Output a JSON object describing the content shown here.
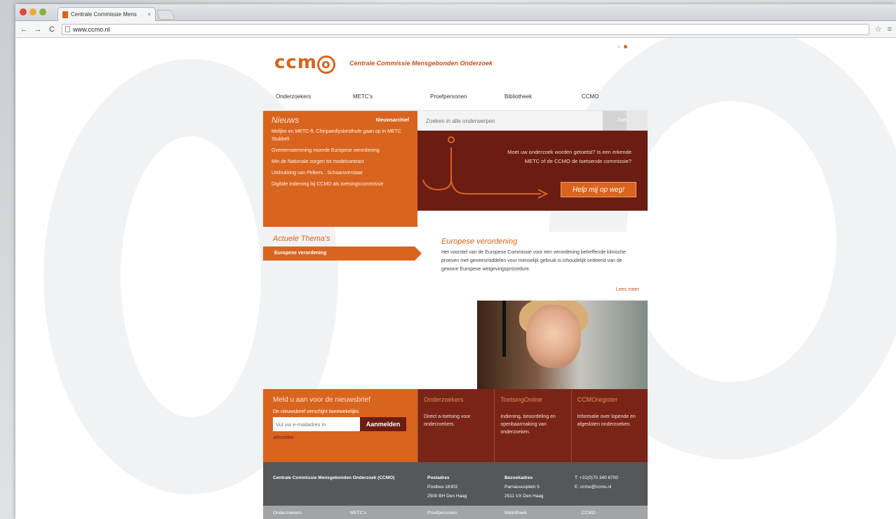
{
  "browser": {
    "tab_title": "Centrale Commissie Mens",
    "tab_close": "×",
    "url": "www.ccmo.nl",
    "back": "←",
    "forward": "→",
    "reload": "C",
    "star": "☆",
    "menu": "≡"
  },
  "site": {
    "logo_text": "ccm",
    "logo_o": "o",
    "tagline": "Centrale Commissie Mensgebonden Onderzoek",
    "search_icon": "⌕",
    "rss_icon": "•"
  },
  "nav": {
    "items": [
      "Onderzoekers",
      "METC's",
      "Proefpersonen",
      "Bibliotheek",
      "CCMO"
    ]
  },
  "news": {
    "title": "Nieuws",
    "all_label": "Nieuwsarchief",
    "items": [
      "Melijke en METC-ft. Chinpaedlyskesthufe gaan op in METC Stubbeli",
      "Overeenstemming moerde Europese verordening",
      "Min de Nationale zorgen tot modelcontract",
      "Uitdrukking van Pelkers . Schaarsverslaat",
      "Digitale indiening bij CCMO als toetsingscommissie"
    ]
  },
  "themas": {
    "title": "Actuele Thema's",
    "item": "Europese verordening"
  },
  "search": {
    "placeholder": "Zoeken in alle onderwerpen",
    "button": "Zoek"
  },
  "hero": {
    "text": "Moet uw onderzoek worden getoetst? Is een erkende METC of de CCMO de toetsende commissie?",
    "button": "Help mij op weg!"
  },
  "article": {
    "title": "Europese verordening",
    "body": "Het voorstel van de Europese Commissie voor een verordening betreffende klinische proeven met geneesmiddelen voor menselijk gebruik is inhoudelijk ontleend van de gewone Europese wetgevingsprocedure.",
    "more": "Lees meer"
  },
  "newsletter": {
    "title": "Meld u aan voor de nieuwsbrief",
    "subtitle": "De nieuwsbrief verschijnt tweewekelijks",
    "placeholder": "Vul uw e-mailadres in",
    "button": "Aanmelden",
    "unsubscribe": "Afmelden"
  },
  "info_cols": [
    {
      "title": "Onderzoekers",
      "text": "Direct a-toetsing voor onderzoekers."
    },
    {
      "title": "ToetsingOnline",
      "text": "Indiening, beoordeling en openbaarmaking van onderzoeken."
    },
    {
      "title": "CCMOregister",
      "text": "Informatie over lopende en afgesloten onderzoeken."
    }
  ],
  "footer": {
    "org": "Centrale Commissie Mensgebonden Onderzoek (CCMO)",
    "postal_title": "Postadres",
    "postal_1": "Postbus 16302",
    "postal_2": "2500 BH Den Haag",
    "visit_title": "Bezoekadres",
    "visit_1": "Parnassusplein 5",
    "visit_2": "2511 VX Den Haag",
    "phone": "T: +31(0)70 340 6700",
    "email": "E: ccmo@ccmo.nl"
  },
  "footer2": {
    "items": [
      "Onderzoekers",
      "METC's",
      "Proefpersonen",
      "Bibliotheek",
      "CCMO"
    ]
  },
  "colors": {
    "orange": "#d9641e",
    "maroon": "#6b1d14",
    "footer_gray": "#555759"
  }
}
